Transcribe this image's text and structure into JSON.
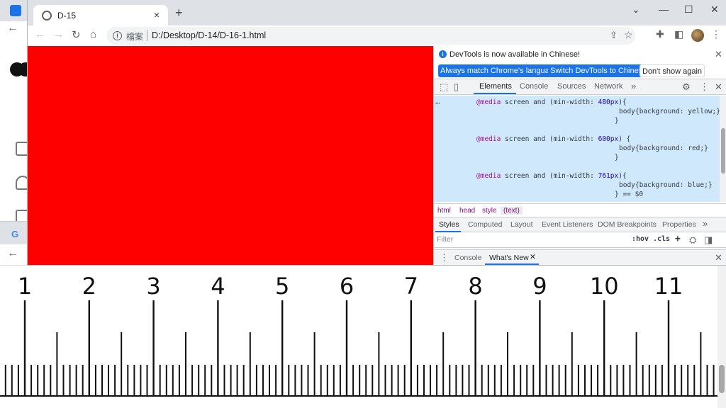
{
  "main_window": {
    "tab_title": "D-15",
    "tab_close_icon": "×",
    "new_tab_icon": "+",
    "window_controls": [
      "⌄",
      "—",
      "☐",
      "✕"
    ],
    "address_scheme": "檔案",
    "address_url": "D:/Desktop/D-14/D-16-1.html",
    "nav": {
      "back": "←",
      "forward": "→",
      "reload": "↻",
      "home": "⌂"
    }
  },
  "page": {
    "background_color": "#ff0000"
  },
  "devtools": {
    "banner_text": "DevTools is now available in Chinese!",
    "banner_buttons": [
      "Always match Chrome's language",
      "Switch DevTools to Chinese",
      "Don't show again"
    ],
    "tabs": [
      "Elements",
      "Console",
      "Sources",
      "Network"
    ],
    "active_tab": "Elements",
    "code": {
      "line1_kw": "@media",
      "line1_a": " screen and (min-width: ",
      "line1_num": "480px",
      "line1_b": "){",
      "line2": "body{background: yellow;}",
      "line3": "}",
      "line4_kw": "@media",
      "line4_a": " screen and (min-width: ",
      "line4_num": "600px",
      "line4_b": ") {",
      "line5": "body{background: red;}",
      "line6": "}",
      "line7_kw": "@media",
      "line7_a": " screen and (min-width: ",
      "line7_num": "761px",
      "line7_b": "){",
      "line8": "body{background: blue;}",
      "line9": "} == $0"
    },
    "breadcrumbs": [
      "html",
      "head",
      "style",
      "(text)"
    ],
    "subtabs": [
      "Styles",
      "Computed",
      "Layout",
      "Event Listeners",
      "DOM Breakpoints",
      "Properties"
    ],
    "filter_placeholder": "Filter",
    "filter_tools": [
      ":hov",
      ".cls",
      "+"
    ],
    "drawer_tabs": [
      "Console",
      "What's New"
    ]
  },
  "ruler": {
    "labels": [
      "1",
      "2",
      "3",
      "4",
      "5",
      "6",
      "7",
      "8",
      "9",
      "10",
      "11"
    ]
  }
}
